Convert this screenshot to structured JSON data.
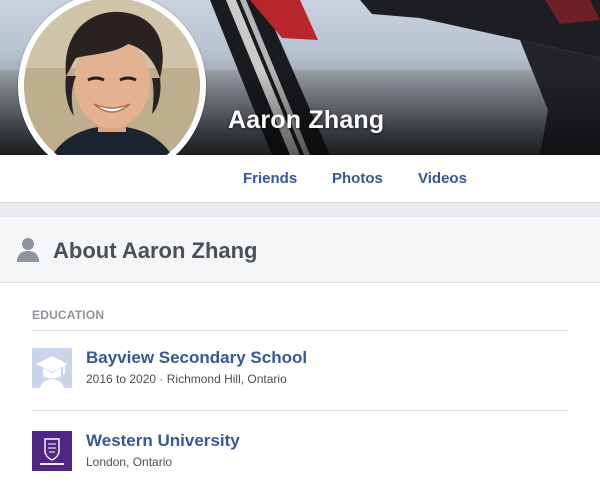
{
  "profile": {
    "name": "Aaron Zhang"
  },
  "nav": {
    "tabs": [
      {
        "label": "Friends"
      },
      {
        "label": "Photos"
      },
      {
        "label": "Videos"
      }
    ]
  },
  "about": {
    "title": "About Aaron Zhang",
    "icon": "person-icon"
  },
  "education": {
    "section_label": "EDUCATION",
    "items": [
      {
        "name": "Bayview Secondary School",
        "details": "2016 to 2020 · Richmond Hill, Ontario",
        "icon": "school-placeholder-icon"
      },
      {
        "name": "Western University",
        "details": "London, Ontario",
        "icon": "western-university-logo"
      }
    ]
  },
  "colors": {
    "link": "#365899",
    "text": "#4b4f56",
    "muted": "#90949c",
    "divider": "#dddfe2",
    "header_bg": "#f5f6f7",
    "western_purple": "#4f2683"
  }
}
